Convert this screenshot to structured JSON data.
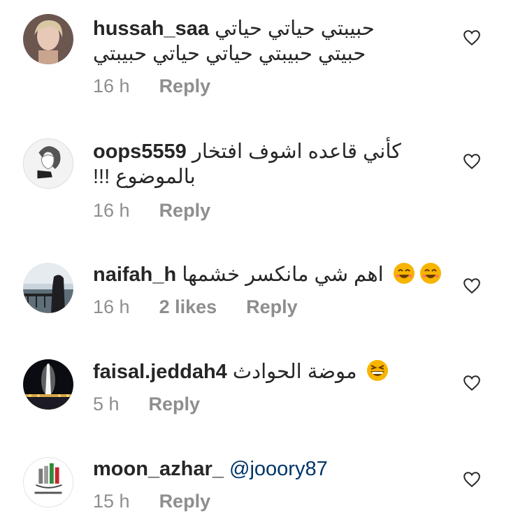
{
  "comments": [
    {
      "username": "hussah_saa",
      "text_line1": "حبيبتي حياتي حياتي",
      "text_line2": "حبيتي حبيبتي حياتي حياتي حبيبتي",
      "time": "16 h",
      "reply_label": "Reply"
    },
    {
      "username": "oops5559",
      "text_line1": "كأني قاعده اشوف افتخار",
      "text_line2": "!!! بالموضوع",
      "time": "16 h",
      "reply_label": "Reply"
    },
    {
      "username": "naifah_h",
      "text_line1": "اهم شي مانكسر خشمها",
      "time": "16 h",
      "likes": "2 likes",
      "reply_label": "Reply"
    },
    {
      "username": "faisal.jeddah4",
      "text_line1": "موضة الحوادث",
      "time": "5 h",
      "reply_label": "Reply"
    },
    {
      "username": "moon_azhar_",
      "mention": "@jooory87",
      "time": "15 h",
      "reply_label": "Reply"
    }
  ],
  "icons": {
    "like": "heart-outline-icon",
    "emoji_smile": "smiling-face-emoji",
    "emoji_laugh": "grinning-squinting-face-emoji"
  },
  "colors": {
    "text": "#262626",
    "secondary": "#8e8e8e",
    "mention": "#003569",
    "divider": "#dbdbdb"
  }
}
